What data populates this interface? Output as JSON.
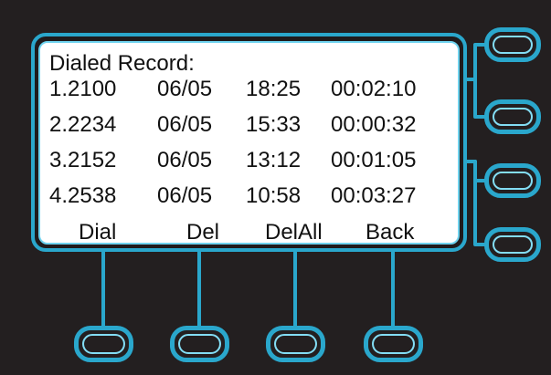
{
  "screen": {
    "title": "Dialed Record:",
    "records": [
      {
        "index": "1.",
        "number": "2100",
        "date": "06/05",
        "time": "18:25",
        "duration": "00:02:10"
      },
      {
        "index": "2.",
        "number": "2234",
        "date": "06/05",
        "time": "15:33",
        "duration": "00:00:32"
      },
      {
        "index": "3.",
        "number": "2152",
        "date": "06/05",
        "time": "13:12",
        "duration": "00:01:05"
      },
      {
        "index": "4.",
        "number": "2538",
        "date": "06/05",
        "time": "10:58",
        "duration": "00:03:27"
      }
    ],
    "softkeys": {
      "dial": "Dial",
      "del": "Del",
      "delall": "DelAll",
      "back": "Back"
    }
  },
  "colors": {
    "device_background": "#231f20",
    "accent": "#2aa7cc",
    "screen_background": "#ffffff",
    "text": "#111111"
  }
}
